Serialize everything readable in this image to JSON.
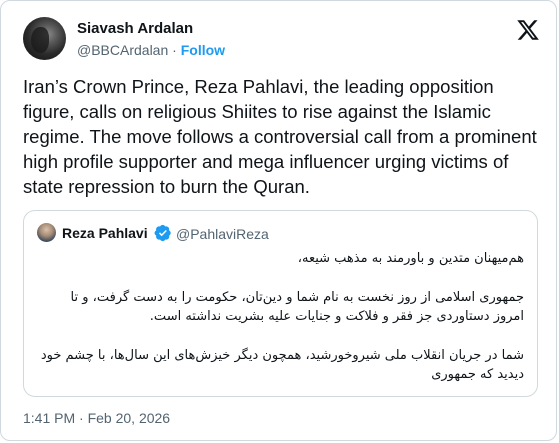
{
  "tweet": {
    "author": {
      "name": "Siavash Ardalan",
      "handle": "@BBCArdalan",
      "separator": "·",
      "follow_label": "Follow"
    },
    "logo_icon": "x-logo-icon",
    "text": "Iran’s Crown Prince, Reza Pahlavi, the leading opposition figure, calls on religious Shiites to rise against the Islamic regime. The move follows a controversial call from a prominent high profile supporter and mega influencer urging victims of state repression to burn the Quran.",
    "quoted": {
      "name": "Reza Pahlavi",
      "verified_icon": "verified-badge-icon",
      "handle": "@PahlaviReza",
      "paragraphs": [
        "هم‌میهنان متدین و باورمند به مذهب شیعه،",
        "جمهوری اسلامی از روز نخست به نام شما و دین‌تان، حکومت را به دست گرفت، و تا امروز دستاوردی جز فقر و فلاکت و جنایات علیه بشریت نداشته است.",
        "شما در جریان انقلاب ملی شیروخورشید، همچون دیگر خیزش‌های این سال‌ها، با چشم خود دیدید که جمهوری"
      ]
    },
    "timestamp": "1:41 PM · Feb 20, 2026"
  },
  "colors": {
    "text_primary": "#0f1419",
    "text_secondary": "#536471",
    "accent_blue": "#1d9bf0",
    "border": "#cfd9de"
  }
}
